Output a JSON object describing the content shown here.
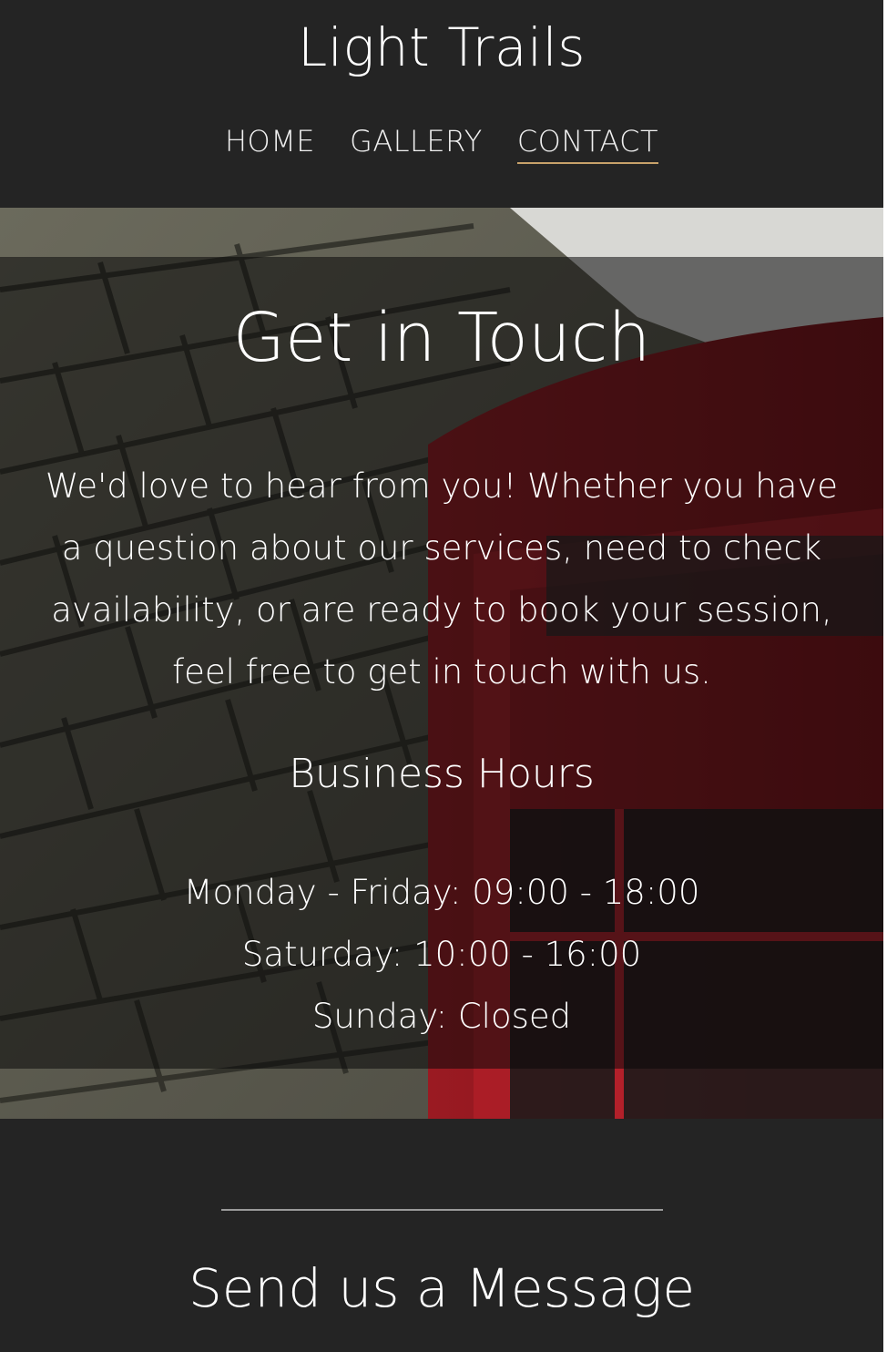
{
  "header": {
    "site_title": "Light Trails",
    "nav": [
      {
        "label": "HOME",
        "active": false
      },
      {
        "label": "GALLERY",
        "active": false
      },
      {
        "label": "CONTACT",
        "active": true
      }
    ],
    "accent_color": "#c8a26a"
  },
  "hero": {
    "heading": "Get in Touch",
    "text": "We'd love to hear from you! Whether you have a question about our services, need to check availability, or are ready to book your session, feel free to get in touch with us.",
    "hours_heading": "Business Hours",
    "hours": [
      "Monday - Friday: 09:00 - 18:00",
      "Saturday: 10:00 - 16:00",
      "Sunday: Closed"
    ]
  },
  "message_section": {
    "heading": "Send us a Message"
  }
}
